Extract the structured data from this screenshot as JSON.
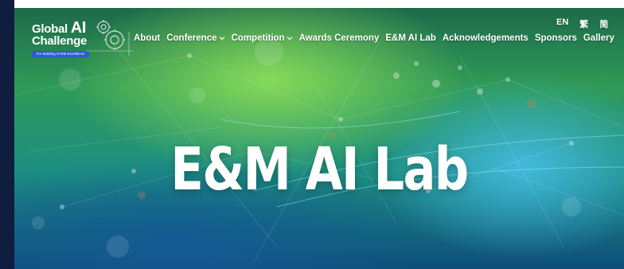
{
  "logo": {
    "line1_text": "Global ",
    "line1_ai": "AI",
    "line2": "Challenge",
    "tagline": "For Building STEM Excellence"
  },
  "nav": {
    "about": "About",
    "conference": "Conference",
    "competition": "Competition",
    "awards_ceremony": "Awards Ceremony",
    "em_ai_lab": "E&M AI Lab",
    "acknowledgements": "Acknowledgements",
    "sponsors": "Sponsors",
    "gallery": "Gallery"
  },
  "language": {
    "english": "EN",
    "traditional_chinese": "繁",
    "simplified_chinese": "简"
  },
  "hero": {
    "title": "E&M AI Lab"
  },
  "colors": {
    "left_strip": "#0f1d3f",
    "logo_tag_bg": "#2a5bd0",
    "hero_green": "#2f9a57",
    "hero_blue": "#0d4e7a"
  },
  "icons": {
    "dropdown": "chevron-down-icon",
    "logo_mark": "gear-icon"
  }
}
